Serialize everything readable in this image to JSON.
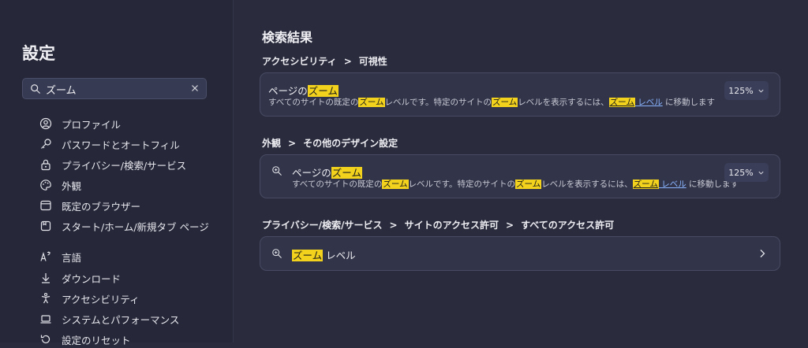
{
  "sidebar": {
    "title": "設定",
    "search": {
      "value": "ズーム"
    },
    "items": [
      {
        "label": "プロファイル",
        "icon": "profile-icon"
      },
      {
        "label": "パスワードとオートフィル",
        "icon": "key-icon"
      },
      {
        "label": "プライバシー/検索/サービス",
        "icon": "lock-icon"
      },
      {
        "label": "外観",
        "icon": "palette-icon"
      },
      {
        "label": "既定のブラウザー",
        "icon": "browser-icon"
      },
      {
        "label": "スタート/ホーム/新規タブ ページ",
        "icon": "home-icon"
      },
      {
        "label": "言語",
        "icon": "language-icon"
      },
      {
        "label": "ダウンロード",
        "icon": "download-icon"
      },
      {
        "label": "アクセシビリティ",
        "icon": "accessibility-icon"
      },
      {
        "label": "システムとパフォーマンス",
        "icon": "laptop-icon"
      },
      {
        "label": "設定のリセット",
        "icon": "reset-icon"
      }
    ]
  },
  "main": {
    "heading": "検索結果",
    "sections": [
      {
        "crumbs": [
          "アクセシビリティ",
          "可視性"
        ],
        "title_pre": "ページの",
        "title_hl": "ズーム",
        "desc": {
          "p1": "すべてのサイトの既定の",
          "hl1": "ズーム",
          "p2": "レベルです。特定のサイトの",
          "hl2": "ズーム",
          "p3": "レベルを表示するには、",
          "link_hl": "ズーム",
          "link_text": " レベル",
          "p4": " に移動します"
        },
        "zoom_value": "125%"
      },
      {
        "crumbs": [
          "外観",
          "その他のデザイン設定"
        ],
        "title_pre": "ページの",
        "title_hl": "ズーム",
        "desc": {
          "p1": "すべてのサイトの既定の",
          "hl1": "ズーム",
          "p2": "レベルです。特定のサイトの",
          "hl2": "ズーム",
          "p3": "レベルを表示するには、",
          "link_hl": "ズーム",
          "link_text": " レベル",
          "p4": " に移動します"
        },
        "zoom_value": "125%"
      },
      {
        "crumbs": [
          "プライバシー/検索/サービス",
          "サイトのアクセス許可",
          "すべてのアクセス許可"
        ],
        "title_hl": "ズーム",
        "title_post": " レベル"
      }
    ],
    "crumb_separator": ">"
  },
  "colors": {
    "background": "#2a2c3e",
    "sidebar": "#26283a",
    "card": "#32354a",
    "highlight": "#f2d21c",
    "link": "#8ab4ff"
  }
}
